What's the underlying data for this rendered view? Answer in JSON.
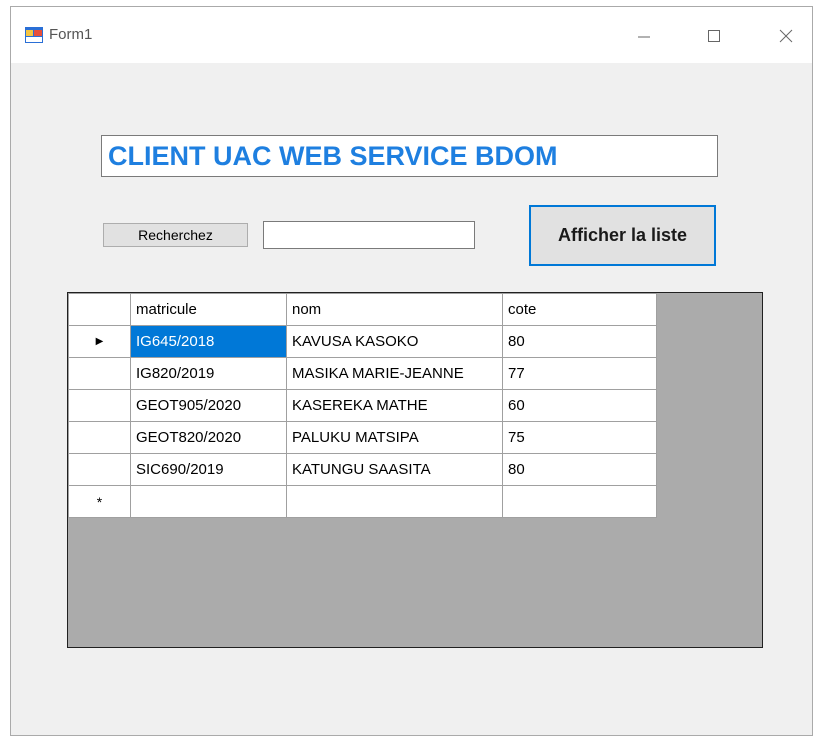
{
  "window": {
    "title": "Form1",
    "controls": {
      "minimize": "minimize-icon",
      "maximize": "maximize-icon",
      "close": "close-icon"
    }
  },
  "header": {
    "title": "CLIENT UAC WEB SERVICE BDOM"
  },
  "search": {
    "button_label": "Recherchez",
    "input_value": ""
  },
  "actions": {
    "show_list_label": "Afficher la liste"
  },
  "grid": {
    "columns": [
      "matricule",
      "nom",
      "cote"
    ],
    "rows": [
      {
        "matricule": "IG645/2018",
        "nom": "KAVUSA KASOKO",
        "cote": "80"
      },
      {
        "matricule": "IG820/2019",
        "nom": "MASIKA MARIE-JEANNE",
        "cote": "77"
      },
      {
        "matricule": "GEOT905/2020",
        "nom": "KASEREKA MATHE",
        "cote": "60"
      },
      {
        "matricule": "GEOT820/2020",
        "nom": "PALUKU MATSIPA",
        "cote": "75"
      },
      {
        "matricule": "SIC690/2019",
        "nom": "KATUNGU SAASITA",
        "cote": "80"
      }
    ],
    "current_row_marker": "▶",
    "new_row_marker": "*",
    "selected_cell": "IG645/2018"
  },
  "colors": {
    "title_text": "#1e7fe0",
    "selection": "#0078d7",
    "grid_background": "#ababab"
  }
}
